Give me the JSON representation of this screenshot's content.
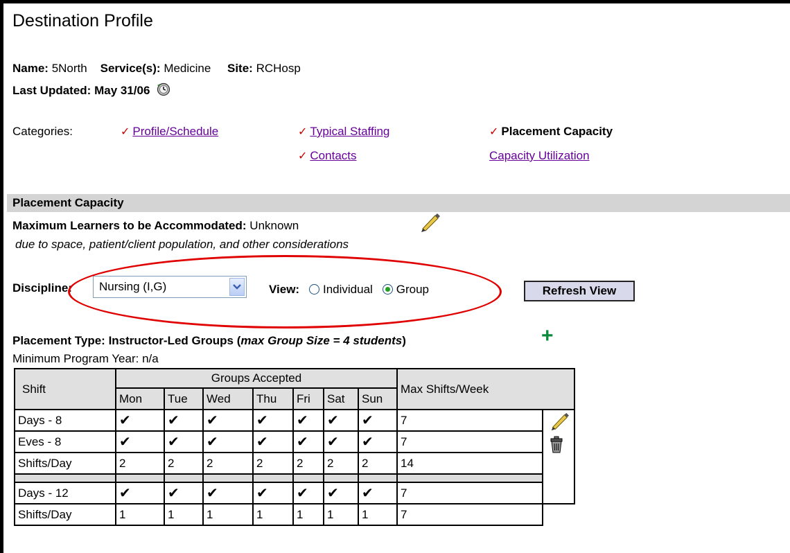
{
  "page": {
    "title": "Destination Profile"
  },
  "info": {
    "name_label": "Name:",
    "name_value": "5North",
    "service_label": "Service(s):",
    "service_value": "Medicine",
    "site_label": "Site:",
    "site_value": "RCHosp",
    "updated_label": "Last Updated:",
    "updated_value": "May 31/06"
  },
  "categories": {
    "label": "Categories:",
    "items": [
      {
        "label": "Profile/Schedule",
        "checked": true,
        "link": true
      },
      {
        "label": "Typical Staffing",
        "checked": true,
        "link": true
      },
      {
        "label": "Placement Capacity",
        "checked": true,
        "link": false
      },
      {
        "label": "Contacts",
        "checked": true,
        "link": true
      },
      {
        "label": "Capacity Utilization",
        "checked": false,
        "link": true
      }
    ]
  },
  "section": {
    "title": "Placement Capacity"
  },
  "max_learners": {
    "label": "Maximum Learners to be Accommodated:",
    "value": "Unknown",
    "note": "due to space, patient/client population, and other considerations"
  },
  "filter": {
    "discipline_label": "Discipline:",
    "discipline_value": "Nursing (I,G)",
    "view_label": "View:",
    "view_options": [
      "Individual",
      "Group"
    ],
    "view_selected": "Group",
    "refresh_label": "Refresh View"
  },
  "placement": {
    "type_label": "Placement Type:",
    "type_value": "Instructor-Led Groups (",
    "max_group": "max Group Size = 4 students",
    "type_close": ")",
    "min_year": "Minimum Program Year: n/a"
  },
  "table": {
    "shift_header": "Shift",
    "groups_header": "Groups Accepted",
    "max_header": "Max Shifts/Week",
    "days": [
      "Mon",
      "Tue",
      "Wed",
      "Thu",
      "Fri",
      "Sat",
      "Sun"
    ],
    "check": "✔",
    "rows": [
      {
        "shift": "Days - 8",
        "cells": [
          "✔",
          "✔",
          "✔",
          "✔",
          "✔",
          "✔",
          "✔"
        ],
        "max": "7"
      },
      {
        "shift": "Eves - 8",
        "cells": [
          "✔",
          "✔",
          "✔",
          "✔",
          "✔",
          "✔",
          "✔"
        ],
        "max": "7"
      },
      {
        "shift": "Shifts/Day",
        "cells": [
          "2",
          "2",
          "2",
          "2",
          "2",
          "2",
          "2"
        ],
        "max": "14"
      },
      {
        "shift": "Days - 12",
        "cells": [
          "✔",
          "✔",
          "✔",
          "✔",
          "✔",
          "✔",
          "✔"
        ],
        "max": "7"
      },
      {
        "shift": "Shifts/Day",
        "cells": [
          "1",
          "1",
          "1",
          "1",
          "1",
          "1",
          "1"
        ],
        "max": "7"
      }
    ]
  }
}
